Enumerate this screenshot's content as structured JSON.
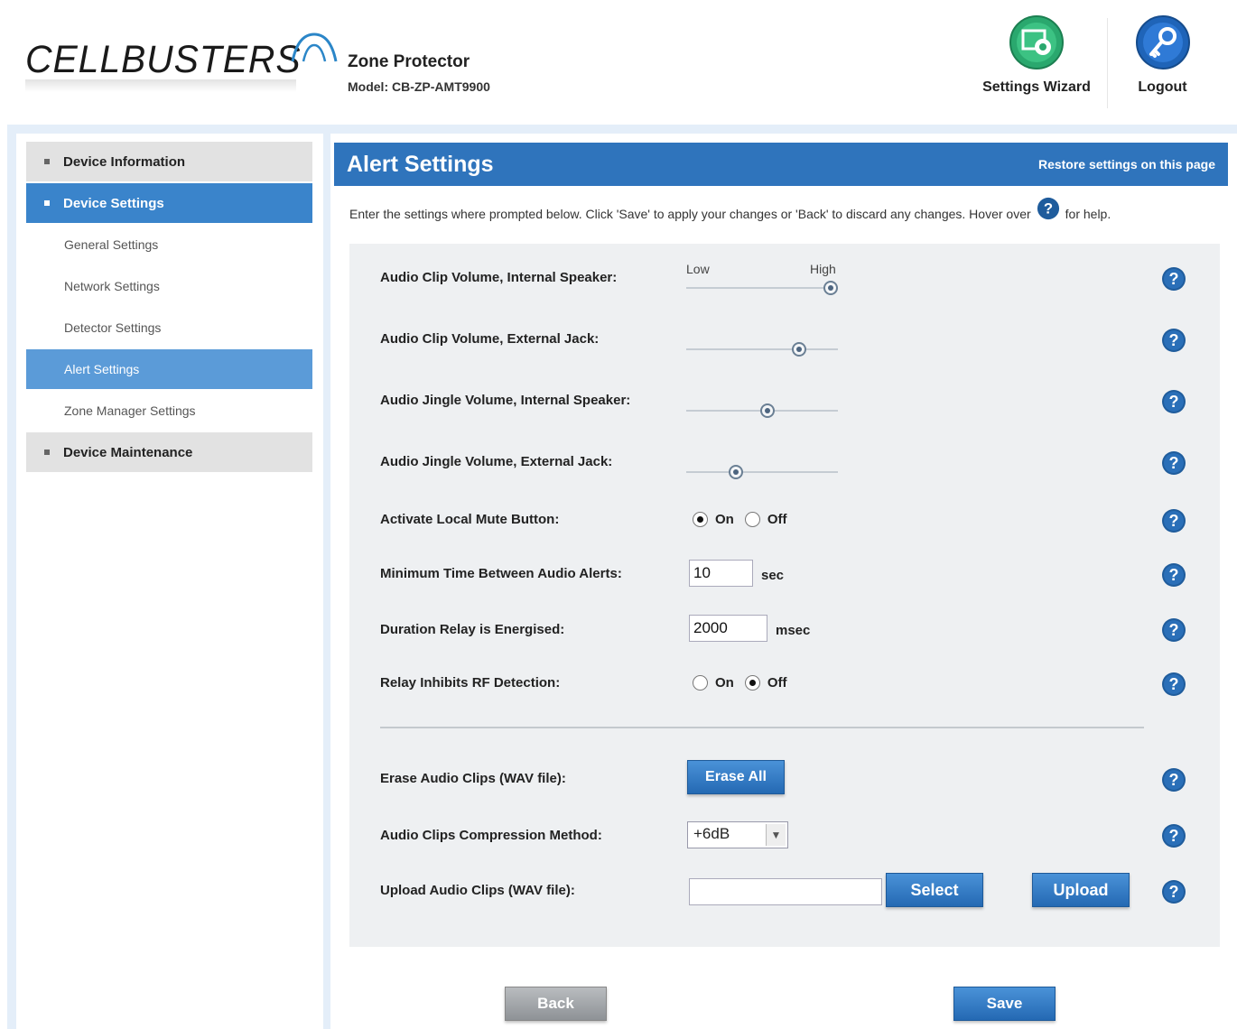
{
  "header": {
    "logo_text": "CELLBUSTERS",
    "product_name": "Zone Protector",
    "model": "Model: CB-ZP-AMT9900",
    "settings_wizard_label": "Settings Wizard",
    "logout_label": "Logout"
  },
  "sidebar": {
    "device_information": "Device Information",
    "device_settings": "Device Settings",
    "general_settings": "General Settings",
    "network_settings": "Network Settings",
    "detector_settings": "Detector Settings",
    "alert_settings": "Alert Settings",
    "zone_manager_settings": "Zone Manager Settings",
    "device_maintenance": "Device Maintenance"
  },
  "page": {
    "title": "Alert Settings",
    "restore": "Restore settings on this page",
    "intro_before": "Enter the settings where prompted below. Click 'Save' to apply your changes or 'Back' to discard any changes. Hover over",
    "intro_after": "for help."
  },
  "settings": {
    "scale_low": "Low",
    "scale_high": "High",
    "clip_internal_label": "Audio Clip Volume, Internal Speaker:",
    "clip_internal_level": 1.0,
    "clip_external_label": "Audio Clip Volume, External Jack:",
    "clip_external_level": 0.77,
    "jingle_internal_label": "Audio Jingle Volume, Internal Speaker:",
    "jingle_internal_level": 0.54,
    "jingle_external_label": "Audio Jingle Volume, External Jack:",
    "jingle_external_level": 0.31,
    "local_mute_label": "Activate Local Mute Button:",
    "local_mute_value": "On",
    "min_time_label": "Minimum Time Between Audio Alerts:",
    "min_time_value": "10",
    "min_time_unit": "sec",
    "relay_duration_label": "Duration Relay is Energised:",
    "relay_duration_value": "2000",
    "relay_duration_unit": "msec",
    "relay_inhibits_label": "Relay Inhibits RF Detection:",
    "relay_inhibits_value": "Off",
    "on_label": "On",
    "off_label": "Off",
    "erase_label": "Erase Audio Clips (WAV file):",
    "erase_button": "Erase All",
    "compression_label": "Audio Clips Compression Method:",
    "compression_value": "+6dB",
    "upload_label": "Upload Audio Clips (WAV file):",
    "upload_file_value": "",
    "select_button": "Select",
    "upload_button": "Upload"
  },
  "footer": {
    "back_button": "Back",
    "save_button": "Save"
  },
  "colors": {
    "title_bar": "#2f74bc",
    "nav_active": "#3a84cb",
    "nav_sub_active": "#5b9bd8",
    "help_icon": "#1f5c9c",
    "wizard_icon": "#2aa86e"
  },
  "icons": {
    "wizard": "settings-gear-icon",
    "logout": "key-icon",
    "help": "question-mark-icon"
  }
}
